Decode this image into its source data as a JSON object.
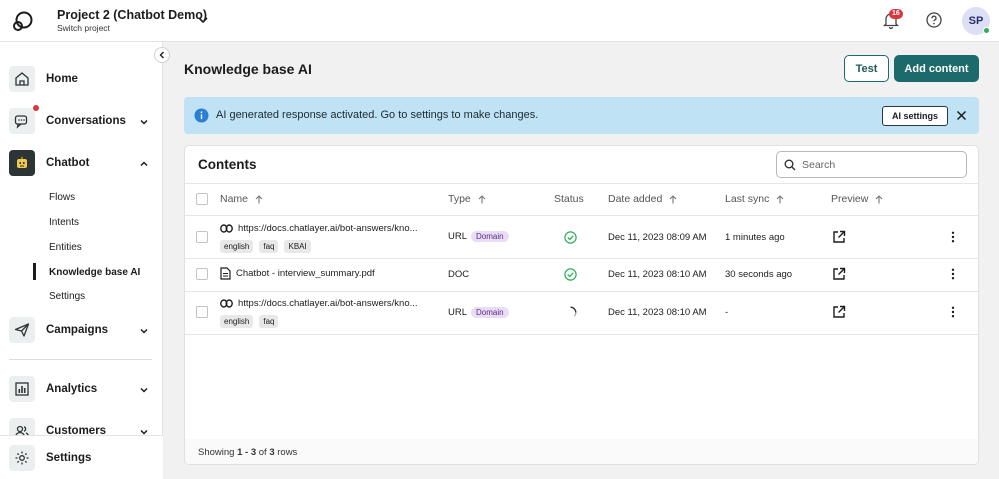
{
  "project": {
    "name": "Project 2 (Chatbot Demo)",
    "subtitle": "Switch project"
  },
  "notifications": {
    "count": "16"
  },
  "user": {
    "initials": "SP"
  },
  "sidebar": {
    "items": [
      {
        "label": "Home",
        "icon": "home-icon"
      },
      {
        "label": "Conversations",
        "icon": "chat-bubbles-icon"
      },
      {
        "label": "Chatbot",
        "icon": "robot-icon"
      },
      {
        "label": "Campaigns",
        "icon": "paper-plane-icon"
      },
      {
        "label": "Analytics",
        "icon": "bar-chart-icon"
      },
      {
        "label": "Customers",
        "icon": "users-icon"
      }
    ],
    "chatbot_sub": [
      "Flows",
      "Intents",
      "Entities",
      "Knowledge base AI",
      "Settings"
    ],
    "settings_label": "Settings"
  },
  "page": {
    "title": "Knowledge base AI",
    "test_label": "Test",
    "add_label": "Add content"
  },
  "alert": {
    "text": "AI generated response activated. Go to settings to make changes.",
    "button": "AI settings"
  },
  "contents": {
    "title": "Contents",
    "search_placeholder": "Search",
    "columns": {
      "name": "Name",
      "type": "Type",
      "status": "Status",
      "date_added": "Date added",
      "last_sync": "Last sync",
      "preview": "Preview"
    },
    "rows": [
      {
        "name": "https://docs.chatlayer.ai/bot-answers/kno...",
        "kind": "link",
        "tags": [
          "english",
          "faq",
          "KBAI"
        ],
        "type": "URL",
        "type_pill": "Domain",
        "status": "done",
        "date_added": "Dec 11, 2023 08:09 AM",
        "last_sync": "1 minutes ago"
      },
      {
        "name": "Chatbot - interview_summary.pdf",
        "kind": "doc",
        "tags": [],
        "type": "DOC",
        "type_pill": "",
        "status": "done",
        "date_added": "Dec 11, 2023 08:10 AM",
        "last_sync": "30 seconds ago"
      },
      {
        "name": "https://docs.chatlayer.ai/bot-answers/kno...",
        "kind": "link",
        "tags": [
          "english",
          "faq"
        ],
        "type": "URL",
        "type_pill": "Domain",
        "status": "loading",
        "date_added": "Dec 11, 2023 08:10 AM",
        "last_sync": "-"
      }
    ],
    "footer": {
      "prefix": "Showing ",
      "range": "1 - 3",
      "of": " of ",
      "total": "3",
      "suffix": " rows"
    }
  },
  "colors": {
    "primary": "#1d6a6a",
    "alert_bg": "#bfe2f4",
    "success": "#2fae5a",
    "badge": "#d9363e",
    "pill_bg": "#e9dcf5"
  }
}
